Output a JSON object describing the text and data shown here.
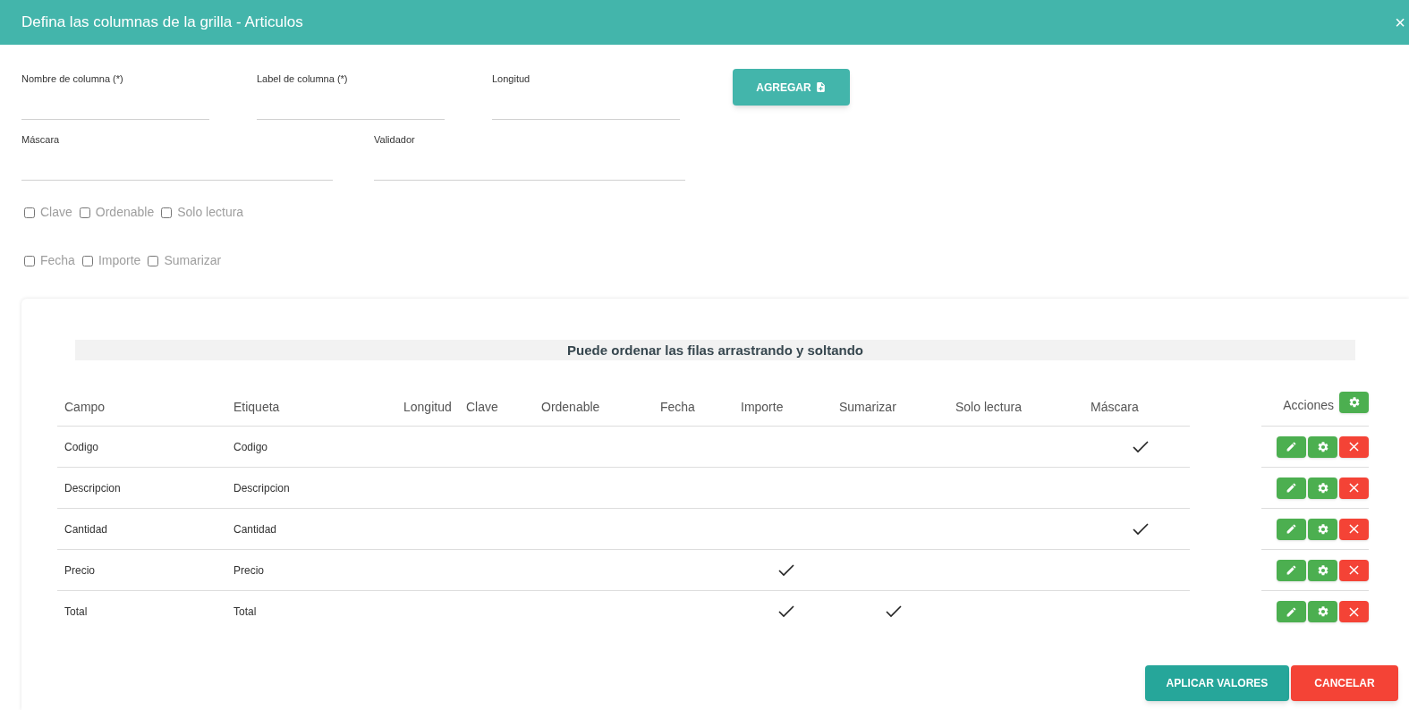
{
  "dialog": {
    "title": "Defina las columnas de la grilla - Articulos",
    "close": "×"
  },
  "form": {
    "field_rows": [
      [
        {
          "label": "Nombre de columna (*)"
        },
        {
          "label": "Label de columna (*)"
        },
        {
          "label": "Longitud"
        }
      ],
      [
        {
          "label": "Máscara"
        },
        {
          "label": "Validador"
        }
      ]
    ],
    "add_button": "AGREGAR",
    "checkbox_rows": [
      [
        {
          "label": "Clave",
          "checked": false
        },
        {
          "label": "Ordenable",
          "checked": false
        },
        {
          "label": "Solo lectura",
          "checked": false
        }
      ],
      [
        {
          "label": "Fecha",
          "checked": false
        },
        {
          "label": "Importe",
          "checked": false
        },
        {
          "label": "Sumarizar",
          "checked": false
        }
      ]
    ]
  },
  "table": {
    "hint": "Puede ordenar las filas arrastrando y soltando",
    "columns": [
      "Campo",
      "Etiqueta",
      "Longitud",
      "Clave",
      "Ordenable",
      "Fecha",
      "Importe",
      "Sumarizar",
      "Solo lectura",
      "Máscara"
    ],
    "actions_header": "Acciones",
    "rows": [
      {
        "campo": "Codigo",
        "etiqueta": "Codigo",
        "clave": false,
        "ordenable": false,
        "fecha": false,
        "importe": false,
        "sumarizar": false,
        "solo_lectura": false,
        "mascara": true
      },
      {
        "campo": "Descripcion",
        "etiqueta": "Descripcion",
        "clave": false,
        "ordenable": false,
        "fecha": false,
        "importe": false,
        "sumarizar": false,
        "solo_lectura": false,
        "mascara": false
      },
      {
        "campo": "Cantidad",
        "etiqueta": "Cantidad",
        "clave": false,
        "ordenable": false,
        "fecha": false,
        "importe": false,
        "sumarizar": false,
        "solo_lectura": false,
        "mascara": true
      },
      {
        "campo": "Precio",
        "etiqueta": "Precio",
        "clave": false,
        "ordenable": false,
        "fecha": false,
        "importe": true,
        "sumarizar": false,
        "solo_lectura": false,
        "mascara": false
      },
      {
        "campo": "Total",
        "etiqueta": "Total",
        "clave": false,
        "ordenable": false,
        "fecha": false,
        "importe": true,
        "sumarizar": true,
        "solo_lectura": false,
        "mascara": false
      }
    ]
  },
  "buttons": [
    {
      "label": "APLICAR VALORES",
      "kind": "primary"
    },
    {
      "label": "CANCELAR",
      "kind": "danger"
    }
  ]
}
